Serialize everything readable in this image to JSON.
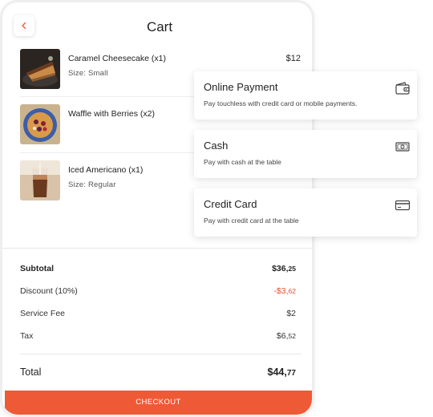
{
  "header": {
    "title": "Cart"
  },
  "items": [
    {
      "name": "Caramel Cheesecake (x1)",
      "option": "Size: Small",
      "price": "$12"
    },
    {
      "name": "Waffle with Berries (x2)",
      "option": "",
      "price": ""
    },
    {
      "name": "Iced Americano (x1)",
      "option": "Size: Regular",
      "price": ""
    }
  ],
  "summary": {
    "subtotal_label": "Subtotal",
    "subtotal_main": "$36,",
    "subtotal_cents": "25",
    "discount_label": "Discount (10%)",
    "discount_main": "-$3,",
    "discount_cents": "62",
    "service_label": "Service Fee",
    "service_value": "$2",
    "tax_label": "Tax",
    "tax_main": "$6,",
    "tax_cents": "52",
    "total_label": "Total",
    "total_main": "$44,",
    "total_cents": "77"
  },
  "checkout_label": "Checkout",
  "payment_options": [
    {
      "title": "Online Payment",
      "description": "Pay touchless with credit card or mobile payments.",
      "icon": "wallet-icon"
    },
    {
      "title": "Cash",
      "description": "Pay with cash at the table",
      "icon": "cash-icon"
    },
    {
      "title": "Credit Card",
      "description": "Pay with credit card at the table",
      "icon": "credit-card-icon"
    }
  ],
  "colors": {
    "accent": "#ee5a35",
    "discount": "#e84e31"
  }
}
